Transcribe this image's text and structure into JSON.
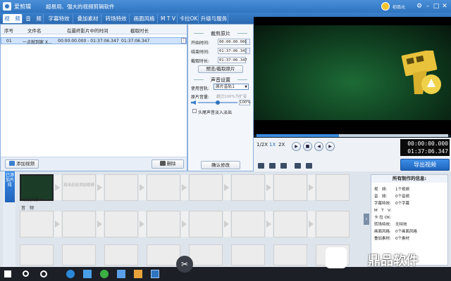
{
  "app": {
    "name": "爱剪辑",
    "slogan": "超易用、强大的视频剪辑软件",
    "user_name": "初品元"
  },
  "window_controls": [
    "⚙",
    "–",
    "□",
    "✕"
  ],
  "tabs": [
    {
      "label": "视　频",
      "active": true
    },
    {
      "label": "音　频",
      "active": false
    },
    {
      "label": "字幕特效",
      "active": false
    },
    {
      "label": "叠加素材",
      "active": false
    },
    {
      "label": "转场特效",
      "active": false
    },
    {
      "label": "画面风格",
      "active": false
    },
    {
      "label": "M T V",
      "active": false
    },
    {
      "label": "卡拉OK",
      "active": false
    },
    {
      "label": "升级与服务",
      "active": false
    }
  ],
  "clip_list": {
    "headers": [
      "序号",
      "文件名",
      "在最终影片中的时间",
      "截取时长"
    ],
    "rows": [
      {
        "index": "01",
        "filename": "一点就到家 X...",
        "range": "00:00:00.000 - 01:37:06.347",
        "duration": "01:37:06.347"
      }
    ],
    "add_button": "添加视频",
    "delete_button": "删除"
  },
  "settings": {
    "trim_title": "裁剪原片",
    "start_label": "开始时间:",
    "start_value": "00:00:00.000",
    "end_label": "结束时间:",
    "end_value": "01:37:06.347",
    "duration_label": "截取时长:",
    "duration_value": "01:37:06.347",
    "preview_button": "预览/截取原片",
    "audio_title": "声音设置",
    "track_label": "使用音轨:",
    "track_value": "原片音轨1",
    "volume_label": "原片音量:",
    "volume_hint": "超过100%为扩音",
    "volume_value": "100%",
    "volume_fraction": 0.5,
    "fade_label": "头尾声音淡入淡出",
    "confirm_button": "确认修改"
  },
  "player": {
    "speeds": [
      "1/2X",
      "1X",
      "2X"
    ],
    "current_time": "00:00:00.000",
    "total_time": "01:37:06.347",
    "progress_fraction": 0.43,
    "export_button": "导出视频"
  },
  "timeline": {
    "side_label": "已添加片段",
    "clip_name": "一点就到家 X",
    "hint_text": "双击此处添加视频",
    "audio_label": "音　频",
    "scroll_arrow": "›"
  },
  "info": {
    "title": "所有制作的信息:",
    "rows": [
      {
        "k": "视　频:",
        "v": "1个视频"
      },
      {
        "k": "音　频:",
        "v": "0个音频"
      },
      {
        "k": "字幕特效:",
        "v": "0个字幕"
      },
      {
        "k": "M　T　V:",
        "v": ""
      },
      {
        "k": "卡 拉 OK:",
        "v": ""
      },
      {
        "k": "转场特效:",
        "v": "无特效"
      },
      {
        "k": "画面风格:",
        "v": "0个画面风格"
      },
      {
        "k": "叠加素材:",
        "v": "0个素材"
      }
    ]
  },
  "watermark": {
    "text": "鼎品软件"
  },
  "colors": {
    "accent": "#2f74c0",
    "export": "#1f64bd",
    "video_green": "#1d6b36"
  }
}
